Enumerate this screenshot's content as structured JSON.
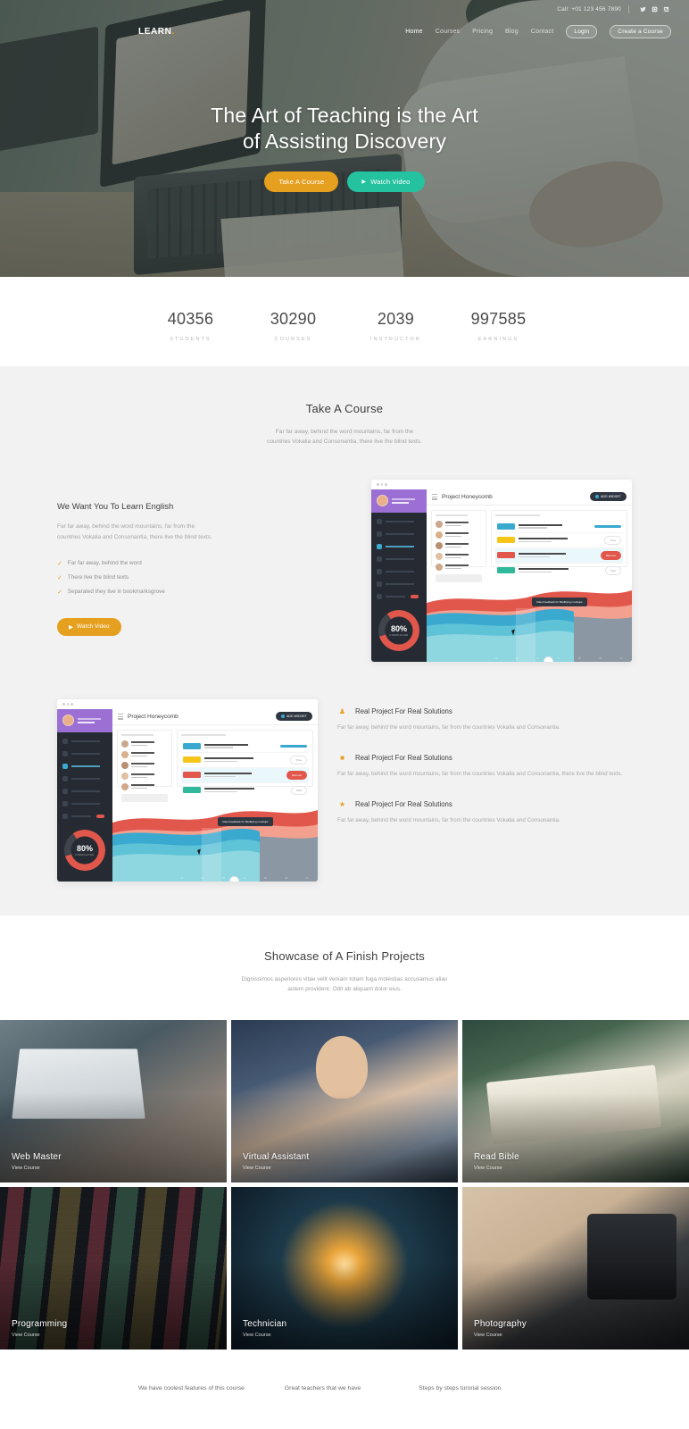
{
  "topbar": {
    "call": "Call: +01 123 456 7890",
    "socials": [
      "twitter-icon",
      "instagram-icon",
      "rss-icon"
    ]
  },
  "nav": {
    "logo": "LEARN",
    "logo_dot": ".",
    "items": [
      {
        "label": "Home",
        "active": true
      },
      {
        "label": "Courses",
        "active": false
      },
      {
        "label": "Pricing",
        "active": false
      },
      {
        "label": "Blog",
        "active": false
      },
      {
        "label": "Contact",
        "active": false
      }
    ],
    "login": "Login",
    "create_course": "Create a Course"
  },
  "hero": {
    "title_line1": "The Art of Teaching is the Art",
    "title_line2": "of Assisting Discovery",
    "btn_course": "Take A Course",
    "btn_video": "Watch Video",
    "play_icon": "play-icon"
  },
  "stats": [
    {
      "value": "40356",
      "label": "STUDENTS"
    },
    {
      "value": "30290",
      "label": "COURSES"
    },
    {
      "value": "2039",
      "label": "INSTRUCTOR"
    },
    {
      "value": "997585",
      "label": "EARNINGS"
    }
  ],
  "course_section": {
    "title": "Take A Course",
    "subtitle_line1": "Far far away, behind the word mountains, far from the",
    "subtitle_line2": "countries Vokalia and Consonantia, there live the blind texts.",
    "block_title": "We Want You To Learn English",
    "block_paragraph": "Far far away, behind the word mountains, far from the countries Vokalia and Consonantia, there live the blind texts.",
    "checks": [
      "Far far away, behind the word",
      "There live the blind texts",
      "Separated they live in bookmarksgrove"
    ],
    "check_icon": "check-icon",
    "watch_button": "Watch Video"
  },
  "dashboard_mock": {
    "title": "Project Honeycomb",
    "add_widget": "ADD WIDGET",
    "progress_value": "80%",
    "progress_label": "COMPLETED",
    "tooltip": "Client feedback for Modifying mockups",
    "x_ticks": [
      "21",
      "22",
      "23",
      "24",
      "25",
      "26",
      "27"
    ]
  },
  "features": [
    {
      "icon": "person-icon",
      "title": "Real Project For Real Solutions",
      "text": "Far far away, behind the word mountains, far from the countries Vokalia and Consonantia."
    },
    {
      "icon": "square-icon",
      "title": "Real Project For Real Solutions",
      "text": "Far far away, behind the word mountains, far from the countries Vokalia and Consonantia, there live the blind texts."
    },
    {
      "icon": "shield-icon",
      "title": "Real Project For Real Solutions",
      "text": "Far far away, behind the word mountains, far from the countries Vokalia and Consonantia."
    }
  ],
  "showcase": {
    "title": "Showcase of A Finish Projects",
    "subtitle_line1": "Dignissimos asperiores vitae velit veniam totam fuga molestias accusamus alias",
    "subtitle_line2": "autem provident. Odit ab aliquam dolor eius.",
    "cards": [
      {
        "title": "Web Master",
        "link": "View Course"
      },
      {
        "title": "Virtual Assistant",
        "link": "View Course"
      },
      {
        "title": "Read Bible",
        "link": "View Course"
      },
      {
        "title": "Programming",
        "link": "View Course"
      },
      {
        "title": "Technician",
        "link": "View Course"
      },
      {
        "title": "Photography",
        "link": "View Course"
      }
    ]
  },
  "bottom_strip": [
    "We have coolest features of this course",
    "Great teachers that we have",
    "Steps by steps turorial session"
  ],
  "colors": {
    "amber": "#e5a01f",
    "teal": "#25c2a0",
    "dark": "#2f3640",
    "red": "#e2574c"
  }
}
